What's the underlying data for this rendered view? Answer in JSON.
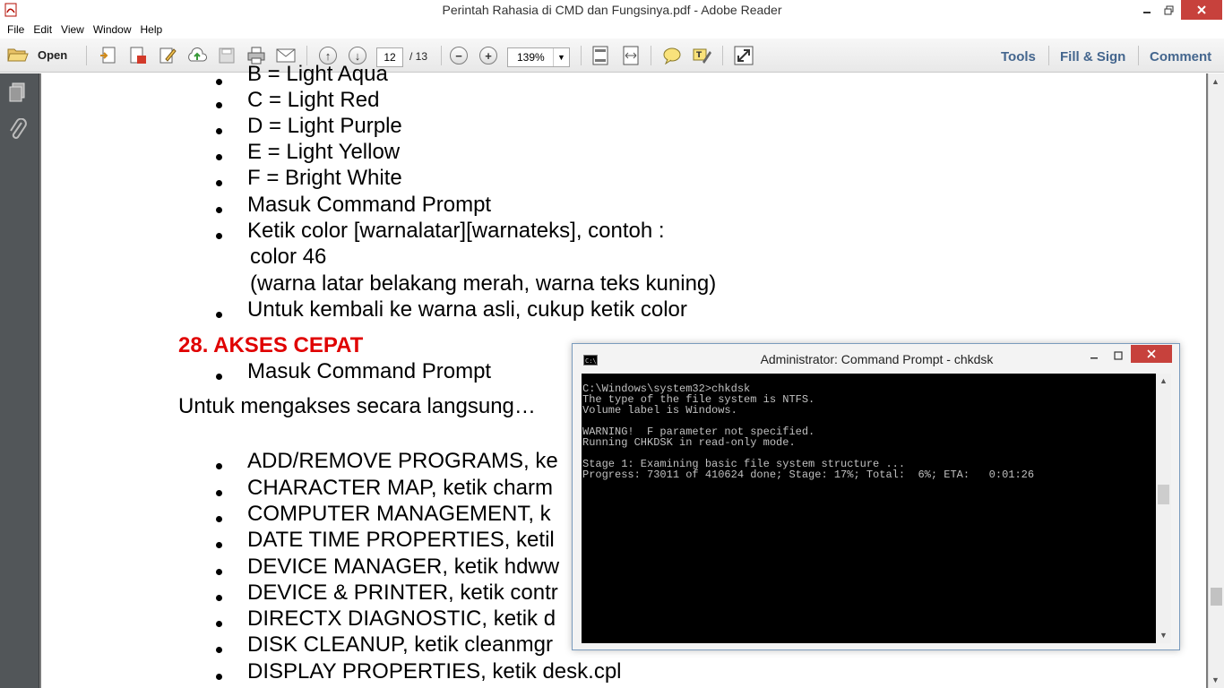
{
  "window": {
    "title": "Perintah Rahasia di CMD dan Fungsinya.pdf - Adobe Reader",
    "minimize_icon": "minimize-icon",
    "restore_icon": "restore-icon",
    "close_icon": "close-icon"
  },
  "menu": {
    "items": [
      "File",
      "Edit",
      "View",
      "Window",
      "Help"
    ]
  },
  "toolbar": {
    "open_label": "Open",
    "page_current": "12",
    "page_total": "/ 13",
    "zoom": "139%",
    "tools_label": "Tools",
    "fill_sign_label": "Fill & Sign",
    "comment_label": "Comment"
  },
  "document": {
    "lines": [
      "B = Light Aqua",
      "C = Light Red",
      "D = Light Purple",
      "E = Light Yellow",
      "F = Bright White",
      "Masuk Command Prompt",
      "Ketik color [warnalatar][warnateks], contoh :",
      "color 46",
      "(warna latar belakang merah, warna teks kuning)",
      "Untuk kembali ke warna asli, cukup ketik color"
    ],
    "heading": "28. AKSES CEPAT",
    "after_heading": "Masuk Command Prompt",
    "intro": "Untuk mengakses secara langsung…",
    "list": [
      "ADD/REMOVE PROGRAMS, ke",
      "CHARACTER MAP, ketik charm",
      "COMPUTER MANAGEMENT, k",
      "DATE TIME PROPERTIES, ketil",
      "DEVICE MANAGER, ketik hdww",
      "DEVICE & PRINTER, ketik contr",
      "DIRECTX DIAGNOSTIC, ketik d",
      "DISK CLEANUP, ketik cleanmgr",
      "DISPLAY PROPERTIES, ketik desk.cpl"
    ]
  },
  "cmd": {
    "title": "Administrator: Command Prompt - chkdsk",
    "output": [
      "C:\\Windows\\system32>chkdsk",
      "The type of the file system is NTFS.",
      "Volume label is Windows.",
      "",
      "WARNING!  F parameter not specified.",
      "Running CHKDSK in read-only mode.",
      "",
      "Stage 1: Examining basic file system structure ...",
      "Progress: 73011 of 410624 done; Stage: 17%; Total:  6%; ETA:   0:01:26"
    ]
  },
  "colors": {
    "heading_red": "#e00000",
    "toolbar_link": "#44668e",
    "close_red": "#c7413c"
  }
}
